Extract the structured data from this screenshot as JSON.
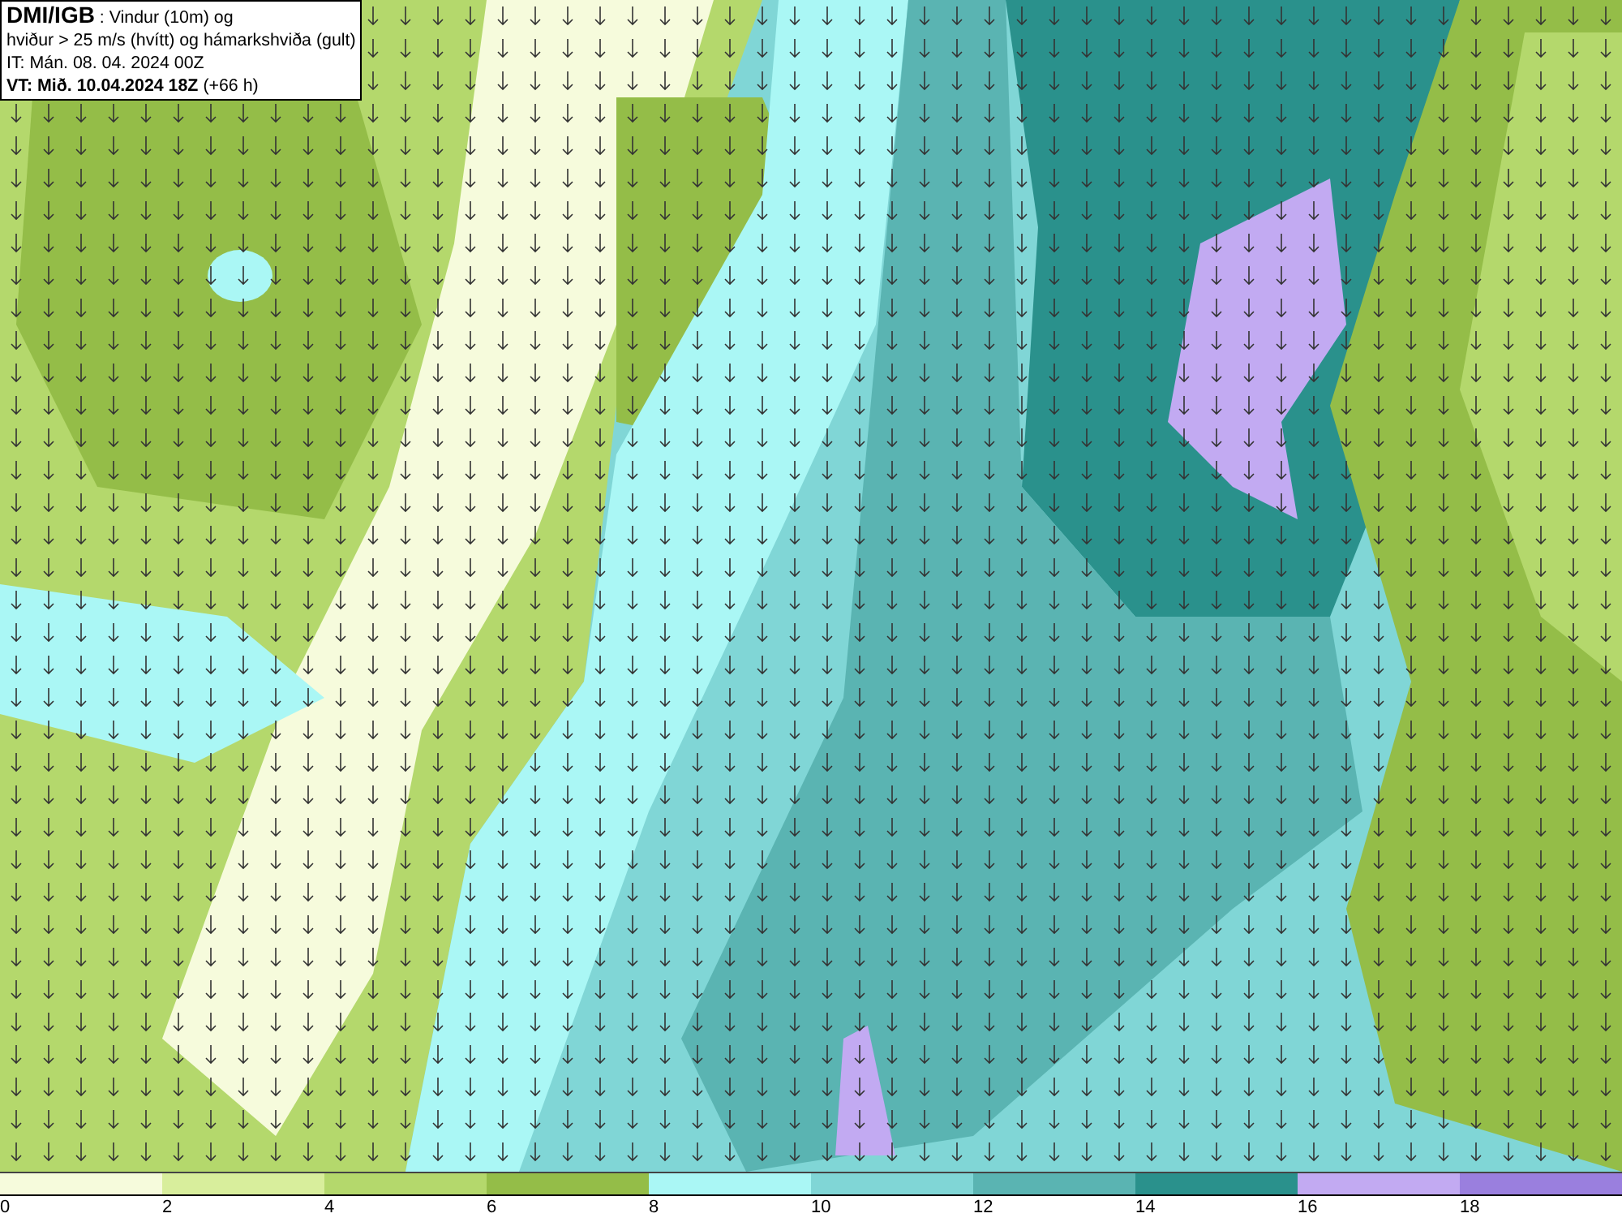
{
  "header": {
    "lines": [
      "**DMI/IGB** : Vindur (10m) og",
      "hviður > 25 m/s (hvítt) og hámarkshviða (gult)",
      "IT: Mán. 08. 04. 2024 00Z",
      "**VT: Mið. 10.04.2024 18Z** (+66 h)"
    ]
  },
  "legend": [
    {
      "label": "0",
      "color": "#f6fbdc"
    },
    {
      "label": "2",
      "color": "#d8ee9c"
    },
    {
      "label": "4",
      "color": "#b4d86c"
    },
    {
      "label": "6",
      "color": "#94bd48"
    },
    {
      "label": "8",
      "color": "#aaf7f5"
    },
    {
      "label": "10",
      "color": "#80d6d6"
    },
    {
      "label": "12",
      "color": "#5ab4b2"
    },
    {
      "label": "14",
      "color": "#2a918c"
    },
    {
      "label": "16",
      "color": "#c2aaf2"
    },
    {
      "label": "18",
      "color": "#9a7fde"
    }
  ]
}
